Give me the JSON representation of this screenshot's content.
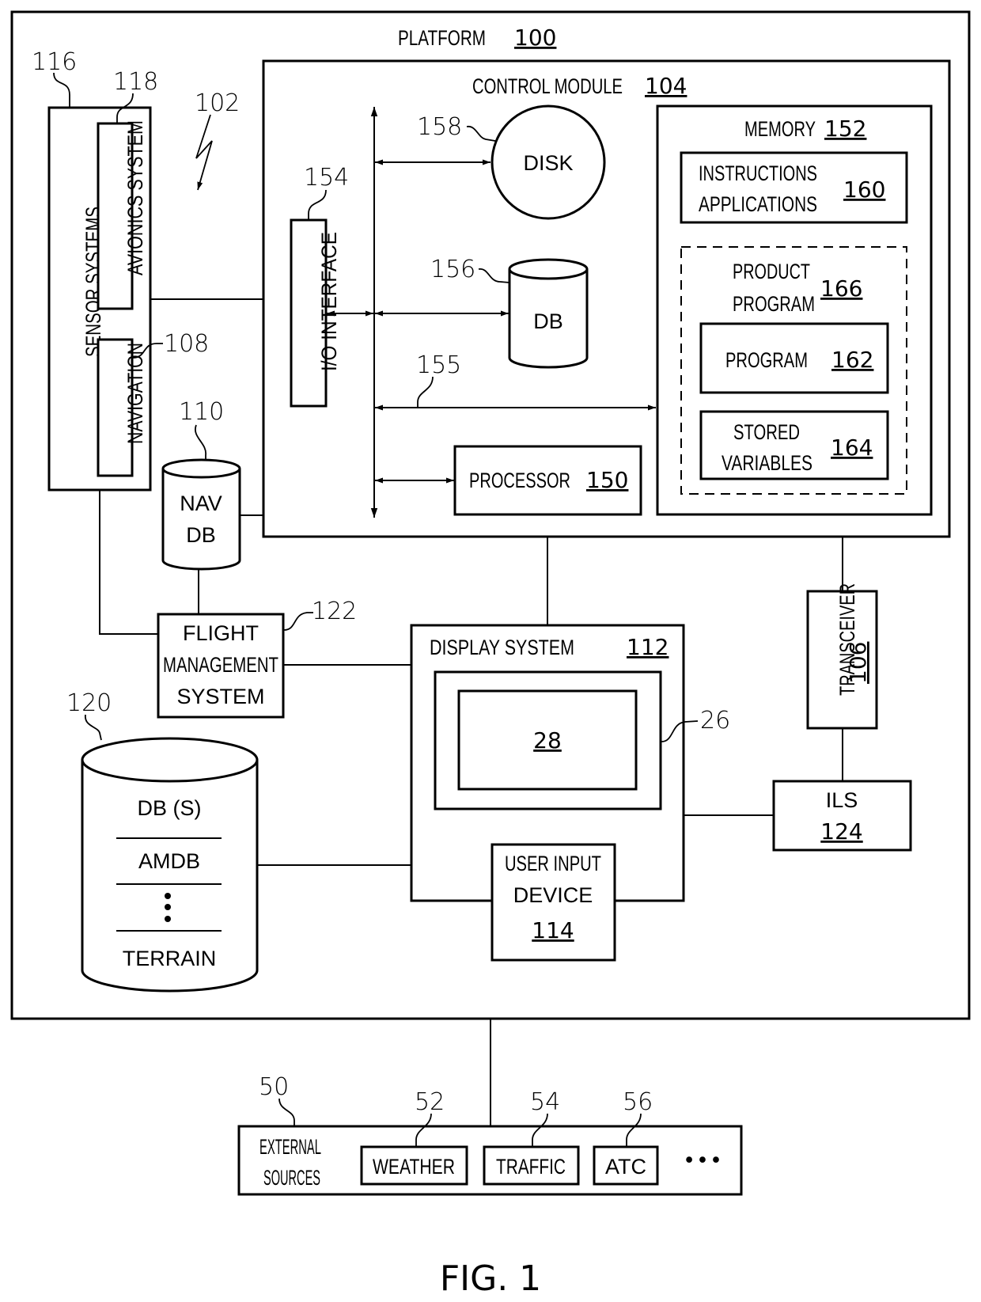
{
  "figure": {
    "caption": "FIG. 1"
  },
  "platform": {
    "title": "PLATFORM",
    "ref": "100"
  },
  "system_ref": "102",
  "control_module": {
    "title": "CONTROL MODULE",
    "ref": "104",
    "io_interface": {
      "label": "I/O INTERFACE",
      "ref": "154"
    },
    "bus": {
      "ref": "155"
    },
    "disk": {
      "label": "DISK",
      "ref": "158"
    },
    "db": {
      "label": "DB",
      "ref": "156"
    },
    "processor": {
      "label": "PROCESSOR",
      "ref": "150"
    },
    "memory": {
      "title": "MEMORY",
      "ref": "152",
      "instructions": {
        "line1": "INSTRUCTIONS",
        "line2": "APPLICATIONS",
        "ref": "160"
      },
      "product_program": {
        "line1": "PRODUCT",
        "line2": "PROGRAM",
        "ref": "166",
        "program": {
          "label": "PROGRAM",
          "ref": "162"
        },
        "stored_variables": {
          "line1": "STORED",
          "line2": "VARIABLES",
          "ref": "164"
        }
      }
    }
  },
  "sensor_systems": {
    "label": "SENSOR SYSTEMS",
    "ref": "116",
    "avionics": {
      "label": "AVIONICS SYSTEM",
      "ref": "118"
    },
    "navigation": {
      "label": "NAVIGATION",
      "ref": "108"
    }
  },
  "nav_db": {
    "line1": "NAV",
    "line2": "DB",
    "ref": "110"
  },
  "fms": {
    "line1": "FLIGHT",
    "line2": "MANAGEMENT",
    "line3": "SYSTEM",
    "ref": "122"
  },
  "databases": {
    "ref": "120",
    "items": [
      "DB (S)",
      "AMDB",
      "TERRAIN"
    ]
  },
  "display_system": {
    "title": "DISPLAY SYSTEM",
    "ref": "112",
    "display": {
      "ref": "26"
    },
    "screen": {
      "ref": "28"
    },
    "user_input": {
      "line1": "USER INPUT",
      "line2": "DEVICE",
      "ref": "114"
    }
  },
  "transceiver": {
    "label": "TRANSCEIVER",
    "ref": "106"
  },
  "ils": {
    "label": "ILS",
    "ref": "124"
  },
  "external_sources": {
    "line1": "EXTERNAL",
    "line2": "SOURCES",
    "ref": "50",
    "sources": [
      {
        "label": "WEATHER",
        "ref": "52"
      },
      {
        "label": "TRAFFIC",
        "ref": "54"
      },
      {
        "label": "ATC",
        "ref": "56"
      }
    ],
    "more": "• • •"
  }
}
